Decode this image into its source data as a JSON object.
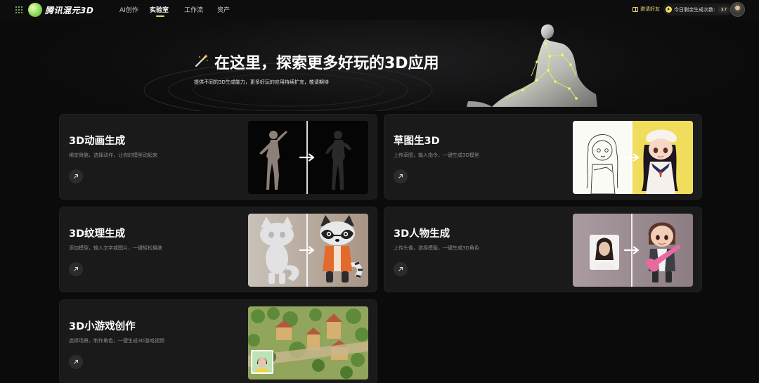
{
  "nav": {
    "logo_text": "腾讯混元3D",
    "tabs": [
      {
        "label": "AI创作",
        "active": false
      },
      {
        "label": "实验室",
        "active": true
      },
      {
        "label": "工作流",
        "active": false
      },
      {
        "label": "资产",
        "active": false
      }
    ],
    "invite_label": "邀请好友",
    "quota_label": "今日剩余生成次数:",
    "quota_value": "37"
  },
  "hero": {
    "title": "在这里，探索更多好玩的3D应用",
    "subtitle": "提供不同的3D生成能力，更多好玩的应用持续扩充，敬请期待"
  },
  "cards": [
    {
      "title": "3D动画生成",
      "desc": "绑定骨骼，选择动作，让你的模型动起来"
    },
    {
      "title": "草图生3D",
      "desc": "上传草图，输入指令，一键生成3D模型"
    },
    {
      "title": "3D纹理生成",
      "desc": "添加模型，输入文字或图片，一键轻松换肤"
    },
    {
      "title": "3D人物生成",
      "desc": "上传头像，选择模版，一键生成3D角色"
    },
    {
      "title": "3D小游戏创作",
      "desc": "选择场景，制作角色，一键生成3D游戏视频"
    }
  ],
  "colors": {
    "accent": "#b9f05d",
    "card_bg": "#1a1a1b",
    "page_bg": "#0b0b0c",
    "gold": "#e8d27a"
  },
  "icons": [
    "grid-icon",
    "logo-icon",
    "gift-icon",
    "play-icon",
    "avatar",
    "magic-wand-icon",
    "arrow-up-right-icon",
    "arrow-right-icon"
  ]
}
